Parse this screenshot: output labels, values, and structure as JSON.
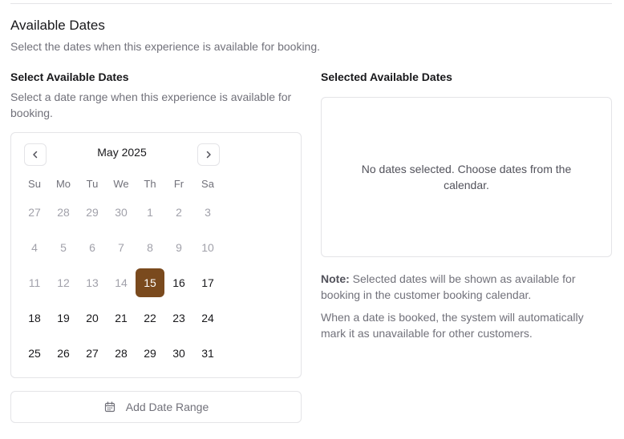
{
  "section": {
    "title": "Available Dates",
    "description": "Select the dates when this experience is available for booking."
  },
  "picker": {
    "title": "Select Available Dates",
    "description": "Select a date range when this experience is available for booking."
  },
  "calendar": {
    "month_label": "May 2025",
    "prev_icon": "chevron-left-icon",
    "next_icon": "chevron-right-icon",
    "weekdays": [
      "Su",
      "Mo",
      "Tu",
      "We",
      "Th",
      "Fr",
      "Sa"
    ],
    "days": [
      {
        "label": "27",
        "state": "muted"
      },
      {
        "label": "28",
        "state": "muted"
      },
      {
        "label": "29",
        "state": "muted"
      },
      {
        "label": "30",
        "state": "muted"
      },
      {
        "label": "1",
        "state": "muted"
      },
      {
        "label": "2",
        "state": "muted"
      },
      {
        "label": "3",
        "state": "muted"
      },
      {
        "label": "4",
        "state": "muted"
      },
      {
        "label": "5",
        "state": "muted"
      },
      {
        "label": "6",
        "state": "muted"
      },
      {
        "label": "7",
        "state": "muted"
      },
      {
        "label": "8",
        "state": "muted"
      },
      {
        "label": "9",
        "state": "muted"
      },
      {
        "label": "10",
        "state": "muted"
      },
      {
        "label": "11",
        "state": "muted"
      },
      {
        "label": "12",
        "state": "muted"
      },
      {
        "label": "13",
        "state": "muted"
      },
      {
        "label": "14",
        "state": "muted"
      },
      {
        "label": "15",
        "state": "selected"
      },
      {
        "label": "16",
        "state": "active"
      },
      {
        "label": "17",
        "state": "active"
      },
      {
        "label": "18",
        "state": "active"
      },
      {
        "label": "19",
        "state": "active"
      },
      {
        "label": "20",
        "state": "active"
      },
      {
        "label": "21",
        "state": "active"
      },
      {
        "label": "22",
        "state": "active"
      },
      {
        "label": "23",
        "state": "active"
      },
      {
        "label": "24",
        "state": "active"
      },
      {
        "label": "25",
        "state": "active"
      },
      {
        "label": "26",
        "state": "active"
      },
      {
        "label": "27",
        "state": "active"
      },
      {
        "label": "28",
        "state": "active"
      },
      {
        "label": "29",
        "state": "active"
      },
      {
        "label": "30",
        "state": "active"
      },
      {
        "label": "31",
        "state": "active"
      }
    ],
    "selected_color": "#7a4a1e"
  },
  "add_range": {
    "label": "Add Date Range",
    "icon": "calendar-icon"
  },
  "selected": {
    "title": "Selected Available Dates",
    "empty_message": "No dates selected. Choose dates from the calendar."
  },
  "notes": {
    "note_label": "Note:",
    "note_text": " Selected dates will be shown as available for booking in the customer booking calendar.",
    "booked_text": "When a date is booked, the system will automatically mark it as unavailable for other customers."
  }
}
